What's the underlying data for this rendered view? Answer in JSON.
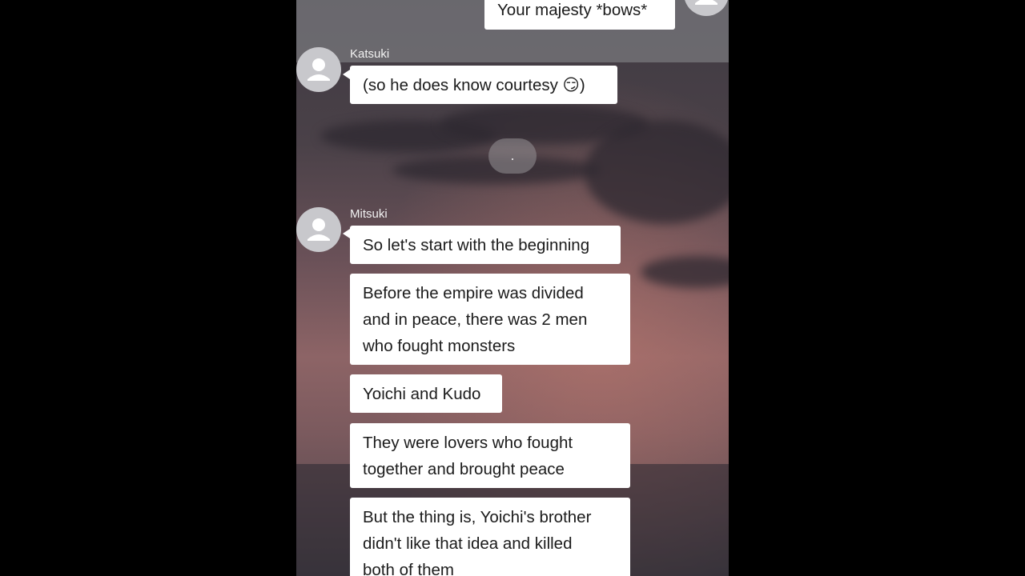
{
  "chat": {
    "top_message": "Your majesty *bows*",
    "katsuki": {
      "name": "Katsuki",
      "message": "(so he does know courtesy 😏)"
    },
    "mitsuki": {
      "name": "Mitsuki",
      "messages": [
        [
          "So let's start with the beginning"
        ],
        [
          "Before the empire was divided",
          "and in peace, there was 2 men",
          "who fought monsters"
        ],
        [
          "Yoichi and Kudo"
        ],
        [
          "They were lovers who fought",
          "together and brought peace"
        ],
        [
          "But the thing is, Yoichi's brother",
          "didn't like that idea and killed",
          "both of them"
        ]
      ]
    },
    "avatar_icon": "default-person-icon",
    "loading_icon": "typing-indicator-icon"
  }
}
